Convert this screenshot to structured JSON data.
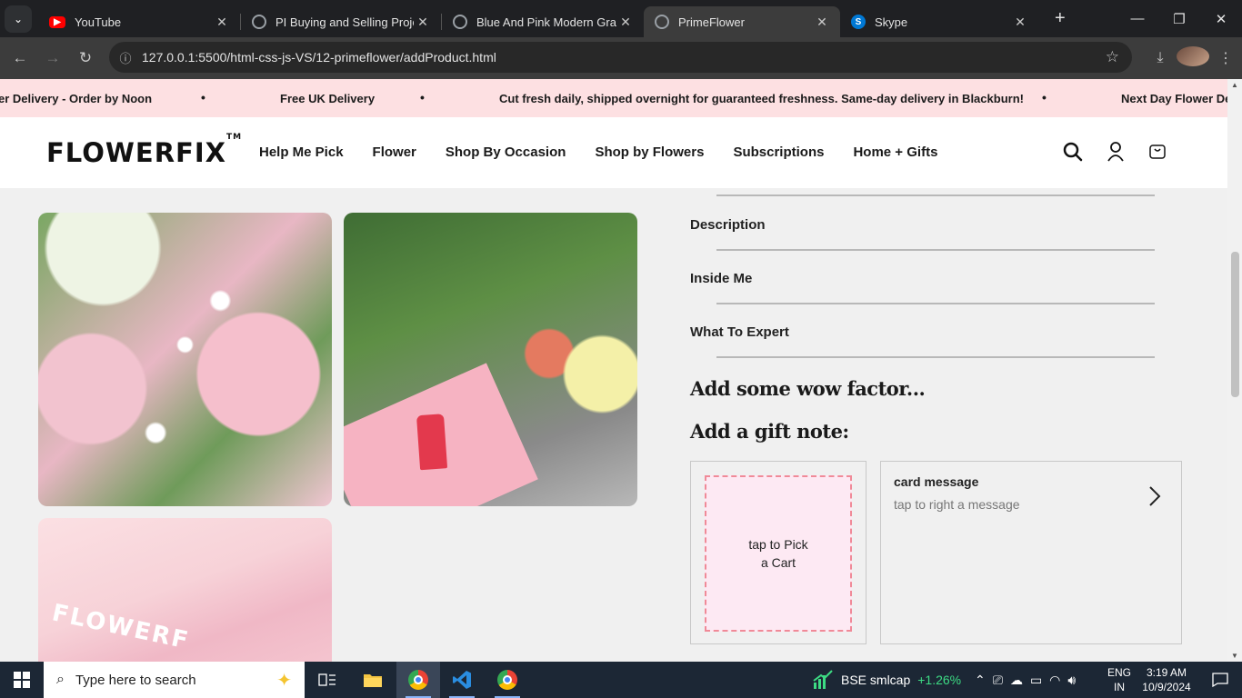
{
  "browser": {
    "tabs": [
      {
        "title": "YouTube",
        "favicon": "youtube-icon",
        "color": "#ff0000"
      },
      {
        "title": "PI Buying and Selling Project",
        "favicon": "globe-icon",
        "color": "#9aa0a6"
      },
      {
        "title": "Blue And Pink Modern Graphic",
        "favicon": "globe-icon",
        "color": "#9aa0a6"
      },
      {
        "title": "PrimeFlower",
        "favicon": "globe-icon",
        "color": "#9aa0a6",
        "active": true
      },
      {
        "title": "Skype",
        "favicon": "skype-icon",
        "color": "#0078d4"
      }
    ],
    "url": "127.0.0.1:5500/html-css-js-VS/12-primeflower/addProduct.html"
  },
  "ticker": {
    "items": [
      "er Delivery - Order by Noon",
      "Free UK Delivery",
      "Cut fresh daily, shipped overnight for guaranteed freshness. Same-day delivery in Blackburn!",
      "Next Day Flower Del"
    ],
    "separator": "•",
    "background": "#fde0e2"
  },
  "header": {
    "logo": "FLOWERFIX",
    "logo_tm": "TM",
    "nav": [
      "Help Me Pick",
      "Flower",
      "Shop By Occasion",
      "Shop by Flowers",
      "Subscriptions",
      "Home + Gifts"
    ]
  },
  "product": {
    "accordion": [
      "Description",
      "Inside Me",
      "What To Expert"
    ],
    "wow_heading": "Add some wow factor...",
    "gift_heading": "Add a gift note:",
    "pick_card": {
      "line1": "tap to Pick",
      "line2": "a Cart"
    },
    "message_card": {
      "title": "card message",
      "subtitle": "tap to right a message"
    },
    "image3_brand": "FLOWERF"
  },
  "taskbar": {
    "search_placeholder": "Type here to search",
    "stock_name": "BSE smlcap",
    "stock_change": "+1.26%",
    "lang_line1": "ENG",
    "lang_line2": "IN",
    "time": "3:19 AM",
    "date": "10/9/2024"
  }
}
